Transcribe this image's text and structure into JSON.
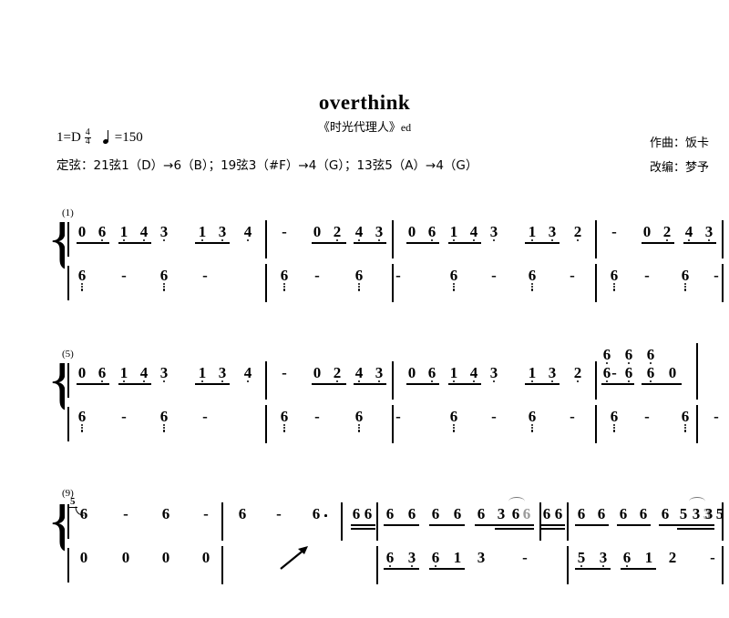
{
  "header": {
    "title": "overthink",
    "subtitle_cn": "《时光代理人》",
    "subtitle_lat": "ed",
    "key_prefix": "1=D",
    "time_num": "4",
    "time_den": "4",
    "tempo_eq": "=150",
    "tuning": "定弦：21弦1（D）→6（B）；19弦3（#F）→4（G）；13弦5（A）→4（G）",
    "composer": "作曲：饭卡",
    "arranger": "改编：梦予"
  },
  "systems": [
    {
      "measure_label": "(1)",
      "treble": [
        {
          "v": "0",
          "dots_below": 0,
          "beam": "start"
        },
        {
          "v": "6",
          "dots_below": 2,
          "beam": "end"
        },
        {
          "v": "1",
          "dots_below": 1,
          "beam": "start"
        },
        {
          "v": "4",
          "dots_below": 1,
          "beam": "end"
        },
        {
          "v": "3",
          "dots_below": 1
        },
        {
          "v": "1",
          "dots_below": 1,
          "beam": "start"
        },
        {
          "v": "3",
          "dots_below": 1,
          "beam": "end"
        },
        {
          "v": "4",
          "dots_below": 1
        },
        {
          "v": "-"
        },
        {
          "v": "0",
          "dots_below": 0,
          "beam": "start"
        },
        {
          "v": "2",
          "dots_below": 1,
          "beam": "end"
        },
        {
          "v": "4",
          "dots_below": 1,
          "beam": "start"
        },
        {
          "v": "3",
          "dots_below": 1,
          "beam": "end"
        },
        {
          "v": "0",
          "dots_below": 0,
          "beam": "start"
        },
        {
          "v": "6",
          "dots_below": 2,
          "beam": "end"
        },
        {
          "v": "1",
          "dots_below": 1,
          "beam": "start"
        },
        {
          "v": "4",
          "dots_below": 1,
          "beam": "end"
        },
        {
          "v": "3",
          "dots_below": 1
        },
        {
          "v": "1",
          "dots_below": 1,
          "beam": "start"
        },
        {
          "v": "3",
          "dots_below": 1,
          "beam": "end"
        },
        {
          "v": "2",
          "dots_below": 1
        },
        {
          "v": "-"
        },
        {
          "v": "0",
          "dots_below": 0,
          "beam": "start"
        },
        {
          "v": "2",
          "dots_below": 1,
          "beam": "end"
        },
        {
          "v": "4",
          "dots_below": 1,
          "beam": "start"
        },
        {
          "v": "3",
          "dots_below": 1,
          "beam": "end"
        }
      ],
      "bass": [
        {
          "v": "6",
          "dots_below": 3
        },
        {
          "v": "-"
        },
        {
          "v": "6",
          "dots_below": 3
        },
        {
          "v": "-"
        },
        {
          "v": "6",
          "dots_below": 3
        },
        {
          "v": "-"
        },
        {
          "v": "6",
          "dots_below": 3
        },
        {
          "v": "-"
        },
        {
          "v": "6",
          "dots_below": 3
        },
        {
          "v": "-"
        },
        {
          "v": "6",
          "dots_below": 3
        },
        {
          "v": "-"
        },
        {
          "v": "6",
          "dots_below": 3
        },
        {
          "v": "-"
        },
        {
          "v": "6",
          "dots_below": 3
        },
        {
          "v": "-"
        }
      ]
    },
    {
      "measure_label": "(5)",
      "treble": [
        {
          "v": "0"
        },
        {
          "v": "6",
          "dots_below": 2
        },
        {
          "v": "1",
          "dots_below": 1
        },
        {
          "v": "4",
          "dots_below": 1
        },
        {
          "v": "3",
          "dots_below": 1
        },
        {
          "v": "1",
          "dots_below": 1
        },
        {
          "v": "3",
          "dots_below": 1
        },
        {
          "v": "4",
          "dots_below": 1
        },
        {
          "v": "-"
        },
        {
          "v": "0"
        },
        {
          "v": "2",
          "dots_below": 1
        },
        {
          "v": "4",
          "dots_below": 1
        },
        {
          "v": "3",
          "dots_below": 1
        },
        {
          "v": "0"
        },
        {
          "v": "6",
          "dots_below": 2
        },
        {
          "v": "1",
          "dots_below": 1
        },
        {
          "v": "4",
          "dots_below": 1
        },
        {
          "v": "3",
          "dots_below": 1
        },
        {
          "v": "1",
          "dots_below": 1
        },
        {
          "v": "3",
          "dots_below": 1
        },
        {
          "v": "2",
          "dots_below": 1
        },
        {
          "v": "-"
        }
      ],
      "chord_upper": [
        {
          "v": "6",
          "dots_below": 1
        },
        {
          "v": "6",
          "dots_below": 1
        },
        {
          "v": "6",
          "dots_below": 1
        }
      ],
      "chord_lower": [
        {
          "v": "6",
          "dots_below": 2
        },
        {
          "v": "6",
          "dots_below": 2
        },
        {
          "v": "6",
          "dots_below": 2
        },
        {
          "v": "0"
        }
      ],
      "bass": [
        {
          "v": "6",
          "dots_below": 3
        },
        {
          "v": "-"
        },
        {
          "v": "6",
          "dots_below": 3
        },
        {
          "v": "-"
        },
        {
          "v": "6",
          "dots_below": 3
        },
        {
          "v": "-"
        },
        {
          "v": "6",
          "dots_below": 3
        },
        {
          "v": "-"
        },
        {
          "v": "6",
          "dots_below": 3
        },
        {
          "v": "-"
        },
        {
          "v": "6",
          "dots_below": 3
        },
        {
          "v": "-"
        },
        {
          "v": "6",
          "dots_below": 3
        },
        {
          "v": "-"
        },
        {
          "v": "6",
          "dots_below": 3
        },
        {
          "v": "-"
        }
      ]
    },
    {
      "measure_label": "(9)",
      "grace": "5",
      "treble": [
        {
          "v": "6"
        },
        {
          "v": "-"
        },
        {
          "v": "6"
        },
        {
          "v": "-"
        },
        {
          "v": "6"
        },
        {
          "v": "-"
        },
        {
          "v": "6",
          "aug_dot": true
        },
        {
          "v": "6"
        },
        {
          "v": "6"
        },
        {
          "v": "6"
        },
        {
          "v": "6"
        },
        {
          "v": "6"
        },
        {
          "v": "6"
        },
        {
          "v": "6"
        },
        {
          "v": "3"
        },
        {
          "v": "6"
        },
        {
          "v": "6",
          "gray": true
        },
        {
          "v": "6"
        },
        {
          "v": "6"
        },
        {
          "v": "6"
        },
        {
          "v": "6"
        },
        {
          "v": "6"
        },
        {
          "v": "6"
        },
        {
          "v": "6"
        },
        {
          "v": "5"
        },
        {
          "v": "3"
        },
        {
          "v": "3",
          "gray": true
        },
        {
          "v": "3"
        },
        {
          "v": "5"
        }
      ],
      "bass": [
        {
          "v": "0"
        },
        {
          "v": "0"
        },
        {
          "v": "0"
        },
        {
          "v": "0"
        },
        {
          "v": "6",
          "dots_below": 2
        },
        {
          "v": "3",
          "dots_below": 1
        },
        {
          "v": "6",
          "dots_below": 1
        },
        {
          "v": "1"
        },
        {
          "v": "3"
        },
        {
          "v": "-"
        },
        {
          "v": "5",
          "dots_below": 2
        },
        {
          "v": "3",
          "dots_below": 1
        },
        {
          "v": "6",
          "dots_below": 1
        },
        {
          "v": "1"
        },
        {
          "v": "2"
        },
        {
          "v": "-"
        }
      ],
      "arrow_label": "glissando-arrow"
    }
  ]
}
